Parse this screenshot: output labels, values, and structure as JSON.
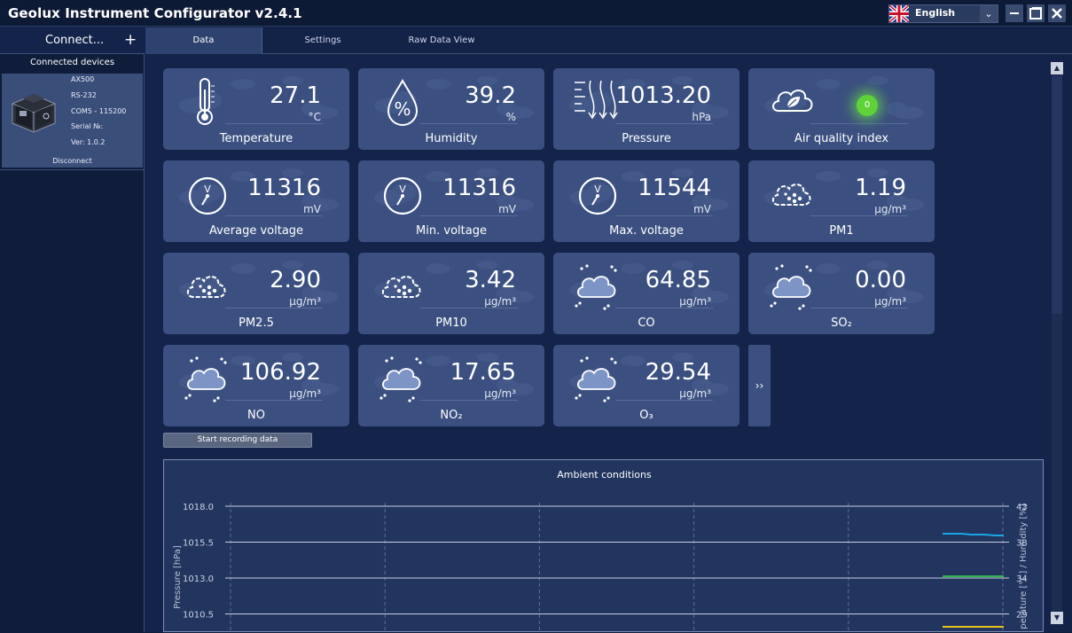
{
  "window": {
    "title": "Geolux Instrument Configurator v2.4.1",
    "language": "English"
  },
  "sidebar": {
    "connect_label": "Connect...",
    "devices_header": "Connected devices",
    "device": {
      "model": "AX500",
      "interface": "RS-232",
      "port": "COM5 - 115200",
      "serial": "Serial №:",
      "version": "Ver: 1.0.2",
      "disconnect": "Disconnect"
    }
  },
  "tabs": [
    {
      "label": "Data",
      "active": true
    },
    {
      "label": "Settings",
      "active": false
    },
    {
      "label": "Raw Data View",
      "active": false
    }
  ],
  "tiles": [
    {
      "name": "temperature",
      "icon": "thermometer-icon",
      "value": "27.1",
      "unit": "°C",
      "label": "Temperature"
    },
    {
      "name": "humidity",
      "icon": "humidity-drop-icon",
      "value": "39.2",
      "unit": "%",
      "label": "Humidity"
    },
    {
      "name": "pressure",
      "icon": "pressure-arrows-icon",
      "value": "1013.20",
      "unit": "hPa",
      "label": "Pressure"
    },
    {
      "name": "air-quality-index",
      "icon": "leaf-cloud-icon",
      "value": "0",
      "unit": "",
      "label": "Air quality index"
    },
    {
      "name": "average-voltage",
      "icon": "voltmeter-icon",
      "value": "11316",
      "unit": "mV",
      "label": "Average voltage"
    },
    {
      "name": "min-voltage",
      "icon": "voltmeter-icon",
      "value": "11316",
      "unit": "mV",
      "label": "Min. voltage"
    },
    {
      "name": "max-voltage",
      "icon": "voltmeter-icon",
      "value": "11544",
      "unit": "mV",
      "label": "Max. voltage"
    },
    {
      "name": "pm1",
      "icon": "particle-cloud-icon",
      "value": "1.19",
      "unit": "μg/m³",
      "label": "PM1"
    },
    {
      "name": "pm2-5",
      "icon": "particle-cloud-icon",
      "value": "2.90",
      "unit": "μg/m³",
      "label": "PM2.5"
    },
    {
      "name": "pm10",
      "icon": "particle-cloud-icon",
      "value": "3.42",
      "unit": "μg/m³",
      "label": "PM10"
    },
    {
      "name": "co",
      "icon": "gas-cloud-icon",
      "value": "64.85",
      "unit": "μg/m³",
      "label": "CO"
    },
    {
      "name": "so2",
      "icon": "gas-cloud-icon",
      "value": "0.00",
      "unit": "μg/m³",
      "label": "SO₂"
    },
    {
      "name": "no",
      "icon": "gas-cloud-icon",
      "value": "106.92",
      "unit": "μg/m³",
      "label": "NO"
    },
    {
      "name": "no2",
      "icon": "gas-cloud-icon",
      "value": "17.65",
      "unit": "μg/m³",
      "label": "NO₂"
    },
    {
      "name": "o3",
      "icon": "gas-cloud-icon",
      "value": "29.54",
      "unit": "μg/m³",
      "label": "O₃"
    }
  ],
  "more_button": "››",
  "record_button": "Start recording data",
  "chart_data": {
    "type": "line",
    "title": "Ambient conditions",
    "ylabel": "Pressure [hPa]",
    "y2label": "perature [°C] / Humidity [%]",
    "ylim": [
      1010.5,
      1018.0
    ],
    "y_ticks": [
      "1018.0",
      "1015.5",
      "1013.0",
      "1010.5"
    ],
    "y2_ticks": [
      "43",
      "38",
      "34",
      "29"
    ],
    "grid": true,
    "colors": {
      "humidity": "#1aa7e6",
      "pressure": "#2fb64a",
      "temperature": "#e8c21f"
    }
  }
}
